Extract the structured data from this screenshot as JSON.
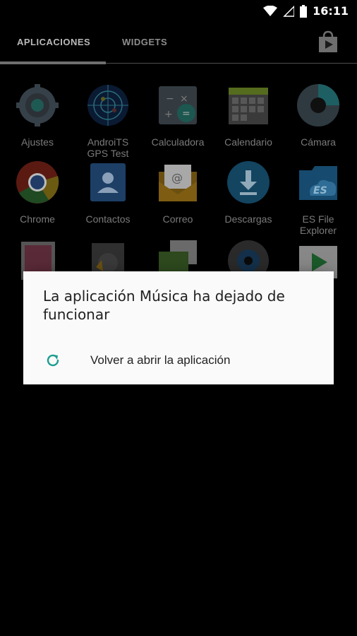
{
  "status_bar": {
    "time": "16:11"
  },
  "tabs": [
    {
      "label": "APLICACIONES",
      "selected": true
    },
    {
      "label": "WIDGETS",
      "selected": false
    }
  ],
  "apps_row1": [
    {
      "label": "Ajustes",
      "icon": "settings-icon"
    },
    {
      "label": "AndroiTS\nGPS Test",
      "icon": "gps-icon"
    },
    {
      "label": "Calculadora",
      "icon": "calculator-icon"
    },
    {
      "label": "Calendario",
      "icon": "calendar-icon"
    },
    {
      "label": "Cámara",
      "icon": "camera-icon"
    }
  ],
  "apps_row2": [
    {
      "label": "Chrome",
      "icon": "chrome-icon"
    },
    {
      "label": "Contactos",
      "icon": "contacts-icon"
    },
    {
      "label": "Correo",
      "icon": "email-icon"
    },
    {
      "label": "Descargas",
      "icon": "download-icon"
    },
    {
      "label": "ES File\nExplorer",
      "icon": "folder-icon"
    }
  ],
  "dialog": {
    "title": "La aplicación Música ha dejado de funcionar",
    "action_label": "Volver a abrir la aplicación"
  }
}
